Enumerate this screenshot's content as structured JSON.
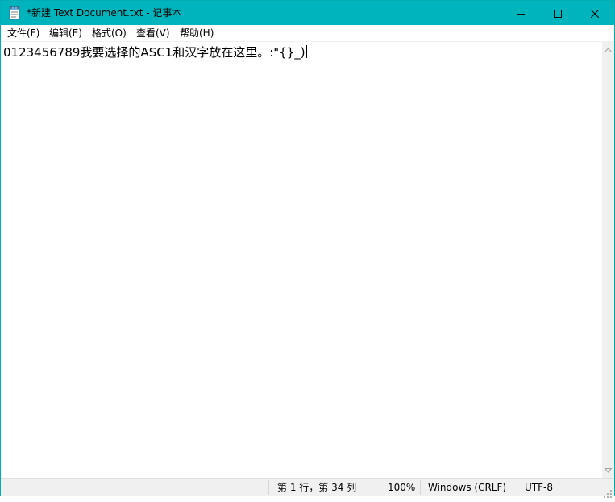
{
  "window": {
    "title": "*新建 Text Document.txt - 记事本",
    "accent_color": "#00b4bd"
  },
  "titlebar": {
    "icon": "notepad-icon",
    "minimize_icon": "minimize-icon",
    "maximize_icon": "maximize-icon",
    "close_icon": "close-icon"
  },
  "menu": {
    "items": [
      {
        "label": "文件(F)"
      },
      {
        "label": "编辑(E)"
      },
      {
        "label": "格式(O)"
      },
      {
        "label": "查看(V)"
      },
      {
        "label": "帮助(H)"
      }
    ]
  },
  "editor": {
    "content": "0123456789我要选择的ASC1和汉字放在这里。:\"{}_)"
  },
  "scrollbar": {
    "up_icon": "scroll-up-arrow-icon",
    "down_icon": "scroll-down-arrow-icon"
  },
  "status": {
    "position": "第 1 行，第 34 列",
    "zoom": "100%",
    "line_ending": "Windows (CRLF)",
    "encoding": "UTF-8"
  }
}
